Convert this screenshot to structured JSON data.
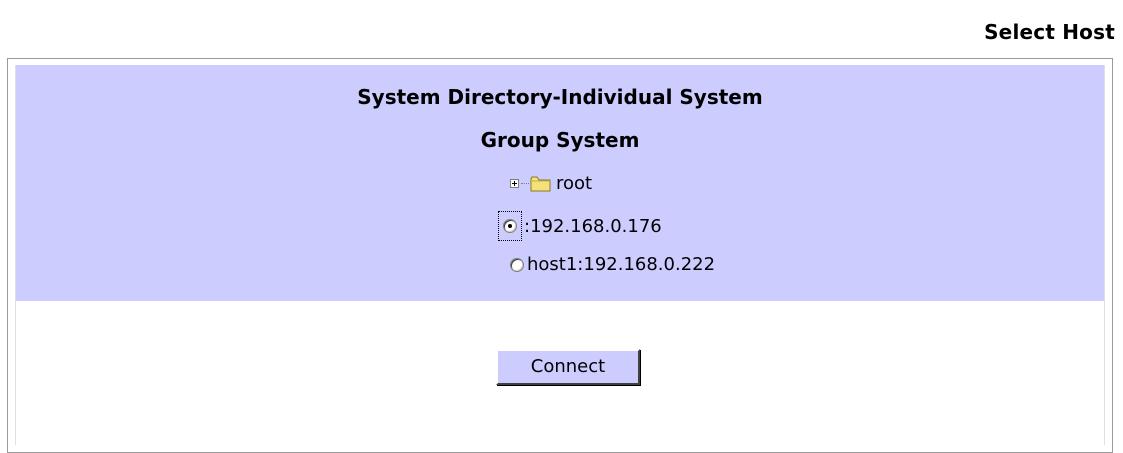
{
  "page": {
    "heading": "Select Host"
  },
  "directory": {
    "title": "System Directory-Individual System",
    "subtitle": "Group System",
    "tree": {
      "root_label": "root",
      "hosts": [
        {
          "label": ":192.168.0.176",
          "selected": true
        },
        {
          "label": "host1:192.168.0.222",
          "selected": false
        }
      ]
    }
  },
  "actions": {
    "connect_label": "Connect"
  },
  "colors": {
    "panel_background": "#ccccff",
    "button_background": "#ccccff",
    "folder": "#f5e17a"
  },
  "icons": {
    "expand": "plus-box-icon",
    "folder": "folder-icon",
    "radio_selected": "radio-checked-icon",
    "radio_unselected": "radio-unchecked-icon"
  }
}
